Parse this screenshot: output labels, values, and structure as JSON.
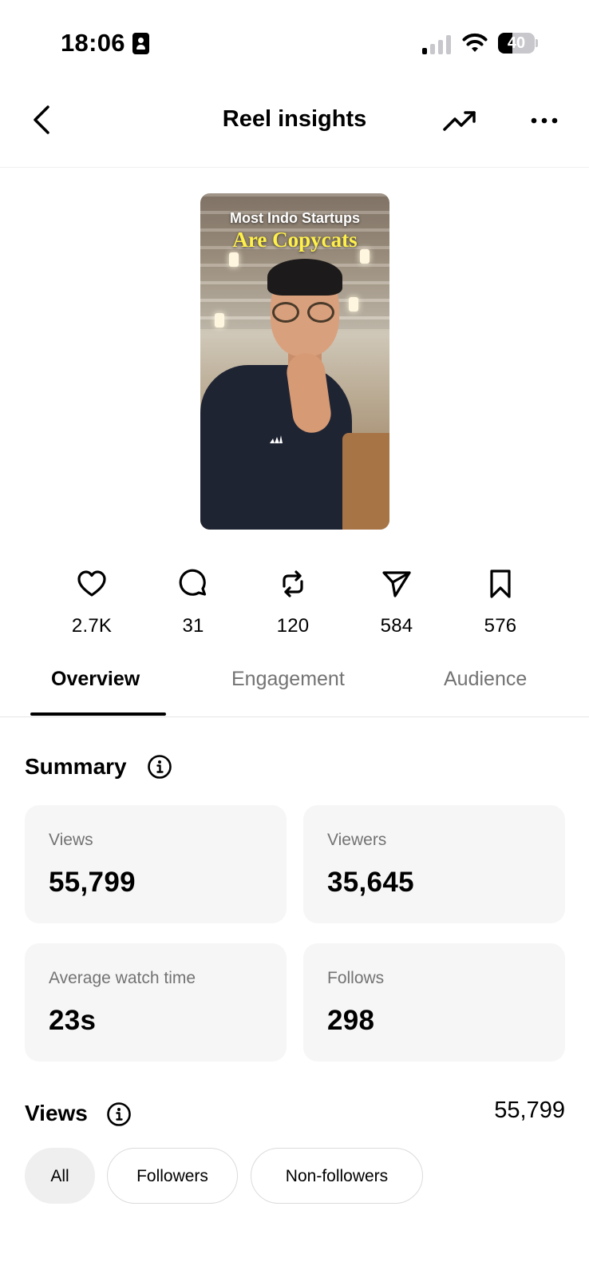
{
  "status_bar": {
    "time": "18:06",
    "battery_percent": "40",
    "battery_level": 0.4,
    "signal_bars_active": 1,
    "signal_bars_total": 4
  },
  "header": {
    "title": "Reel insights"
  },
  "reel": {
    "caption_line_1": "Most Indo Startups",
    "caption_line_2": "Are Copycats"
  },
  "stats": [
    {
      "icon": "heart-icon",
      "value": "2.7K"
    },
    {
      "icon": "comment-icon",
      "value": "31"
    },
    {
      "icon": "repost-icon",
      "value": "120"
    },
    {
      "icon": "share-icon",
      "value": "584"
    },
    {
      "icon": "bookmark-icon",
      "value": "576"
    }
  ],
  "tabs": [
    {
      "label": "Overview",
      "active": true
    },
    {
      "label": "Engagement",
      "active": false
    },
    {
      "label": "Audience",
      "active": false
    }
  ],
  "summary": {
    "title": "Summary",
    "cards": [
      {
        "label": "Views",
        "value": "55,799"
      },
      {
        "label": "Viewers",
        "value": "35,645"
      },
      {
        "label": "Average watch time",
        "value": "23s"
      },
      {
        "label": "Follows",
        "value": "298"
      }
    ]
  },
  "views": {
    "title": "Views",
    "total": "55,799",
    "filters": [
      {
        "label": "All",
        "selected": true
      },
      {
        "label": "Followers",
        "selected": false
      },
      {
        "label": "Non-followers",
        "selected": false
      }
    ]
  },
  "colors": {
    "text_primary": "#000000",
    "text_secondary": "#737373",
    "card_background": "#f6f6f6",
    "caption_highlight": "#fff04a"
  }
}
